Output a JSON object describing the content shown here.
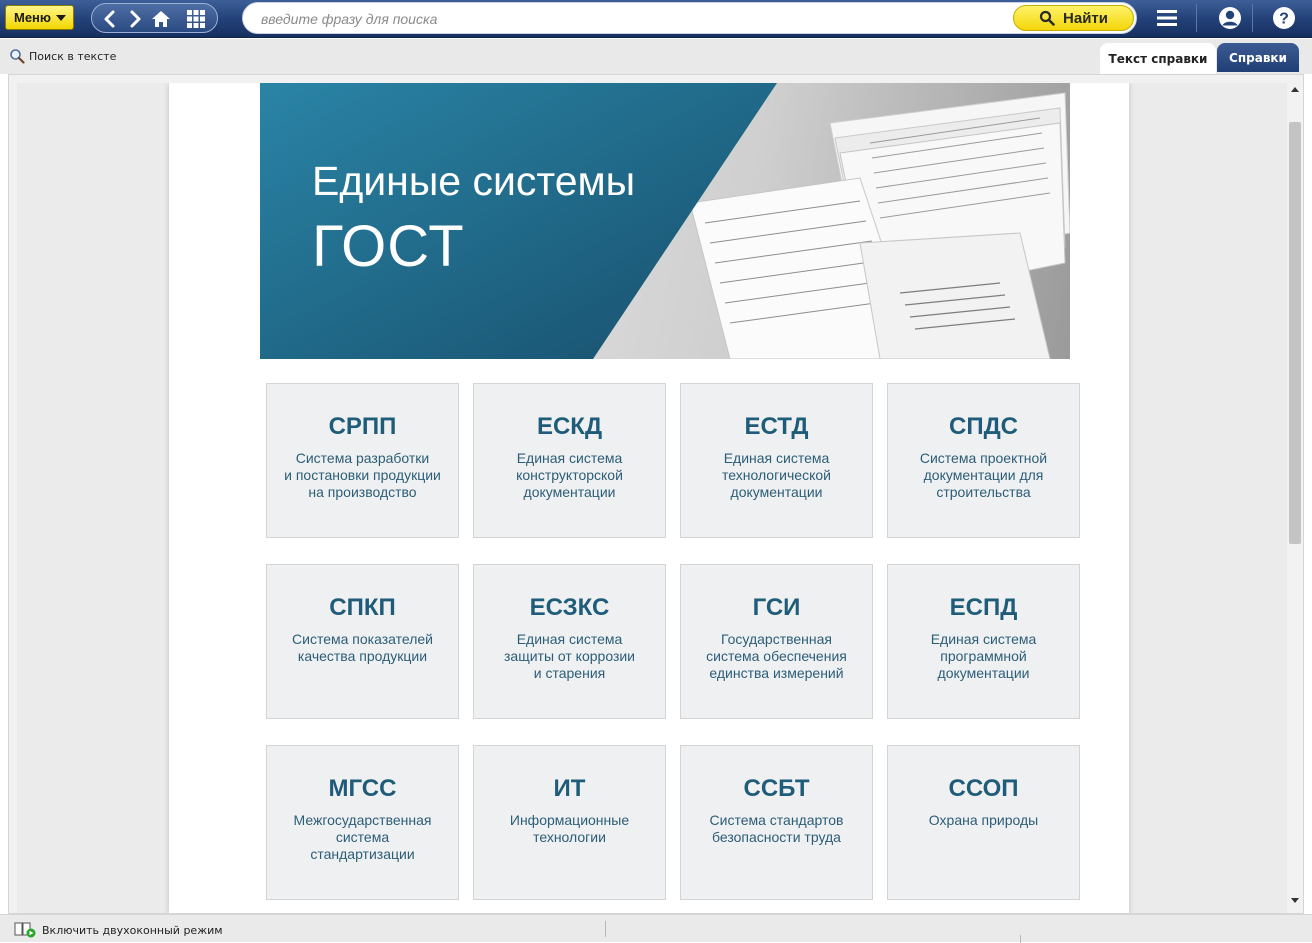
{
  "toolbar": {
    "menu_label": "Меню",
    "search_placeholder": "введите фразу для поиска",
    "find_label": "Найти"
  },
  "subbar": {
    "search_in_text": "Поиск в тексте",
    "tabs": [
      "Текст справки",
      "Справки"
    ]
  },
  "banner": {
    "title": "Единые системы",
    "subtitle": "ГОСТ"
  },
  "cards": [
    {
      "abbr": "СРПП",
      "desc": "Система разработки\nи постановки продукции\nна производство"
    },
    {
      "abbr": "ЕСКД",
      "desc": "Единая система\nконструкторской\nдокументации"
    },
    {
      "abbr": "ЕСТД",
      "desc": "Единая система\nтехнологической\nдокументации"
    },
    {
      "abbr": "СПДС",
      "desc": "Система проектной\nдокументации для\nстроительства"
    },
    {
      "abbr": "СПКП",
      "desc": "Система показателей\nкачества продукции"
    },
    {
      "abbr": "ЕСЗКС",
      "desc": "Единая система\nзащиты от коррозии\nи старения"
    },
    {
      "abbr": "ГСИ",
      "desc": "Государственная\nсистема обеспечения\nединства измерений"
    },
    {
      "abbr": "ЕСПД",
      "desc": "Единая система\nпрограммной\nдокументации"
    },
    {
      "abbr": "МГСС",
      "desc": "Межгосударственная\nсистема\nстандартизации"
    },
    {
      "abbr": "ИТ",
      "desc": "Информационные\nтехнологии"
    },
    {
      "abbr": "ССБТ",
      "desc": "Система стандартов\nбезопасности труда"
    },
    {
      "abbr": "ССОП",
      "desc": "Охрана природы"
    }
  ],
  "statusbar": {
    "dual_mode": "Включить двухоконный режим"
  },
  "colors": {
    "toolbar_blue": "#24427a",
    "accent_yellow": "#f3d60a",
    "banner_teal": "#1f6f8f",
    "card_text": "#1f5c7a"
  },
  "icons": [
    "back-icon",
    "forward-icon",
    "home-icon",
    "grid-icon",
    "search-icon",
    "hamburger-icon",
    "user-icon",
    "help-icon",
    "magnifier-icon",
    "dual-window-icon"
  ]
}
